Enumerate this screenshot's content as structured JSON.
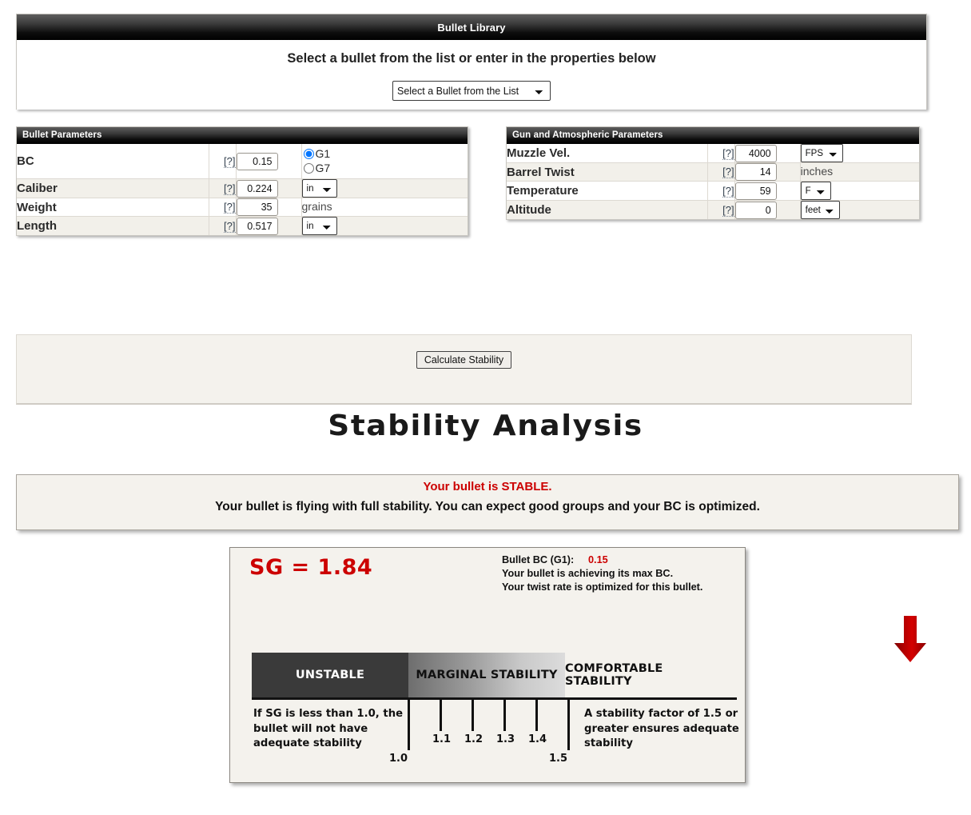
{
  "bullet_library": {
    "title": "Bullet Library",
    "prompt": "Select a bullet from the list or enter in the properties below",
    "select_value": "Select a Bullet from the List"
  },
  "bullet_parameters": {
    "title": "Bullet Parameters",
    "help_glyph": "[?]",
    "rows": [
      {
        "label": "BC",
        "value": "0.15",
        "unit": "",
        "unit_type": "radio"
      },
      {
        "label": "Caliber",
        "value": "0.224",
        "unit": "in",
        "unit_type": "select"
      },
      {
        "label": "Weight",
        "value": "35",
        "unit": "grains",
        "unit_type": "text"
      },
      {
        "label": "Length",
        "value": "0.517",
        "unit": "in",
        "unit_type": "select"
      }
    ],
    "drag_options": [
      {
        "label": "G1",
        "selected": true
      },
      {
        "label": "G7",
        "selected": false
      }
    ]
  },
  "gun_parameters": {
    "title": "Gun and Atmospheric Parameters",
    "help_glyph": "[?]",
    "rows": [
      {
        "label": "Muzzle Vel.",
        "value": "4000",
        "unit": "FPS",
        "unit_type": "select"
      },
      {
        "label": "Barrel Twist",
        "value": "14",
        "unit": "inches",
        "unit_type": "text"
      },
      {
        "label": "Temperature",
        "value": "59",
        "unit": "F",
        "unit_type": "select"
      },
      {
        "label": "Altitude",
        "value": "0",
        "unit": "feet",
        "unit_type": "select"
      }
    ]
  },
  "calculate": {
    "button_label": "Calculate Stability"
  },
  "analysis": {
    "heading": "Stability Analysis",
    "status_title": "Your bullet is STABLE.",
    "status_detail": "Your bullet is flying with full stability. You can expect good groups and your BC is optimized.",
    "status_title_color": "#cc0000"
  },
  "stability_graphic": {
    "sg_text": "SG = 1.84",
    "sg_value": 1.84,
    "bc_label": "Bullet BC (G1):",
    "bc_value": "0.15",
    "bc_line2": "Your bullet is achieving its max BC.",
    "bc_line3": "Your twist rate is optimized for this bullet.",
    "arrow_color": "#c00000",
    "segments": [
      {
        "label": "UNSTABLE",
        "range": "below 1.0"
      },
      {
        "label": "MARGINAL STABILITY",
        "range": "1.0 - 1.5"
      },
      {
        "label": "COMFORTABLE STABILITY",
        "range": "1.5 and above"
      }
    ],
    "ticks": [
      "1.0",
      "1.1",
      "1.2",
      "1.3",
      "1.4",
      "1.5"
    ],
    "note_left": "If SG is less than 1.0, the bullet will not have adequate stability",
    "note_right": "A stability factor of 1.5 or greater ensures adequate stability"
  }
}
